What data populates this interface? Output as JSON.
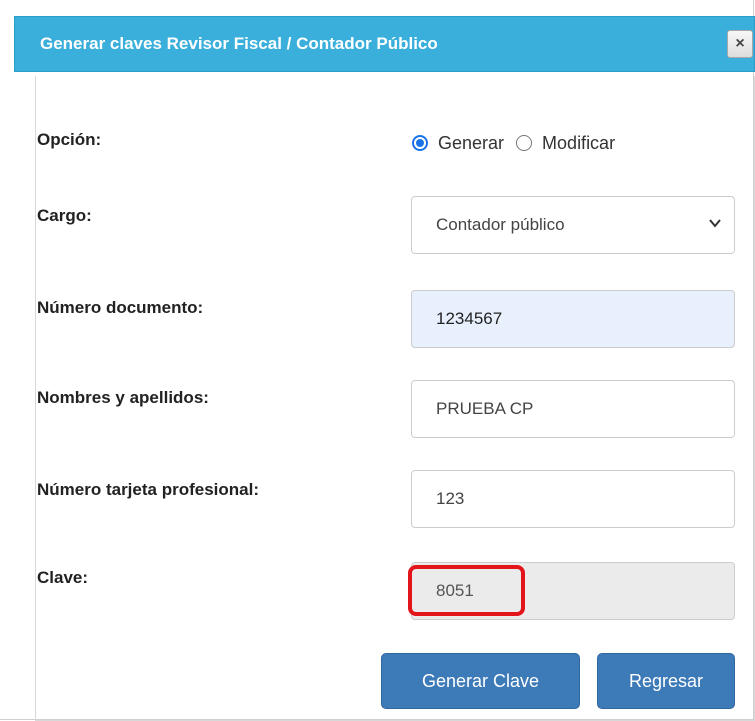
{
  "dialog": {
    "title": "Generar claves Revisor Fiscal / Contador Público",
    "close_label": "×"
  },
  "form": {
    "option_label": "Opción:",
    "option_values": [
      "Generar",
      "Modificar"
    ],
    "option_selected": "Generar",
    "cargo_label": "Cargo:",
    "cargo_value": "Contador público",
    "documento_label": "Número documento:",
    "documento_value": "1234567",
    "nombres_label": "Nombres y apellidos:",
    "nombres_value": "PRUEBA CP",
    "tarjeta_label": "Número tarjeta profesional:",
    "tarjeta_value": "123",
    "clave_label": "Clave:",
    "clave_value": "8051"
  },
  "buttons": {
    "generar": "Generar Clave",
    "regresar": "Regresar"
  },
  "colors": {
    "header": "#3aafdb",
    "button": "#3d7ab8",
    "highlight_box": "#e4141b"
  }
}
